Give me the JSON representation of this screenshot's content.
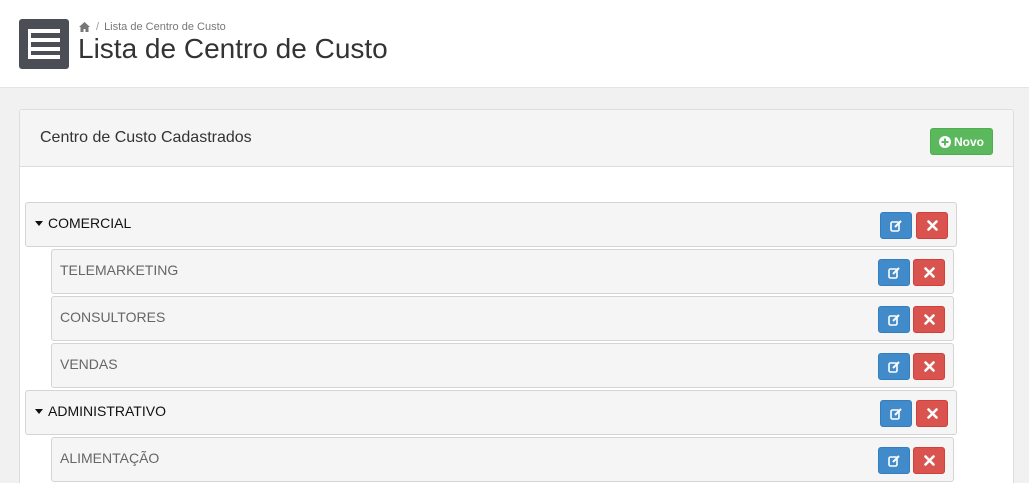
{
  "header": {
    "breadcrumb": "Lista de Centro de Custo",
    "title": "Lista de Centro de Custo",
    "menu_icon": "menu-icon",
    "home_icon": "home-icon"
  },
  "panel": {
    "title": "Centro de Custo Cadastrados",
    "new_button": "Novo"
  },
  "tree": [
    {
      "label": "COMERCIAL",
      "level": "parent"
    },
    {
      "label": "TELEMARKETING",
      "level": "child"
    },
    {
      "label": "CONSULTORES",
      "level": "child"
    },
    {
      "label": "VENDAS",
      "level": "child"
    },
    {
      "label": "ADMINISTRATIVO",
      "level": "parent"
    },
    {
      "label": "ALIMENTAÇÃO",
      "level": "child"
    }
  ],
  "colors": {
    "edit": "#428bca",
    "delete": "#d9534f",
    "new": "#5cb85c"
  }
}
